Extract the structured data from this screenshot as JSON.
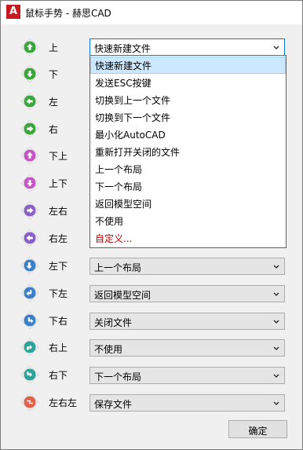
{
  "window": {
    "title": "鼠标手势 - 赫思CAD"
  },
  "app_icon": {
    "glyph": "A",
    "color": "#c8191f"
  },
  "gestures": [
    {
      "label": "上",
      "icon": "arrow-up-icon",
      "icon_color": "#3aa53a",
      "value": "快速新建文件"
    },
    {
      "label": "下",
      "icon": "arrow-down-icon",
      "icon_color": "#3aa53a"
    },
    {
      "label": "左",
      "icon": "arrow-left-icon",
      "icon_color": "#3aa53a"
    },
    {
      "label": "右",
      "icon": "arrow-right-icon",
      "icon_color": "#3aa53a"
    },
    {
      "label": "下上",
      "icon": "arrow-down-up-icon",
      "icon_color": "#c356c3"
    },
    {
      "label": "上下",
      "icon": "arrow-up-down-icon",
      "icon_color": "#c356c3"
    },
    {
      "label": "左右",
      "icon": "arrow-left-right-icon",
      "icon_color": "#8a5fc8"
    },
    {
      "label": "右左",
      "icon": "arrow-right-left-icon",
      "icon_color": "#8a5fc8"
    },
    {
      "label": "左下",
      "icon": "arrow-left-down-icon",
      "icon_color": "#3a7fc8",
      "value": "上一个布局"
    },
    {
      "label": "下左",
      "icon": "arrow-down-left-icon",
      "icon_color": "#3a7fc8",
      "value": "返回模型空间"
    },
    {
      "label": "下右",
      "icon": "arrow-down-right-icon",
      "icon_color": "#3a7fc8",
      "value": "关闭文件"
    },
    {
      "label": "右上",
      "icon": "arrow-right-up-icon",
      "icon_color": "#2aa39a",
      "value": "不使用"
    },
    {
      "label": "右下",
      "icon": "arrow-right-down-icon",
      "icon_color": "#2aa39a",
      "value": "下一个布局"
    },
    {
      "label": "左右左",
      "icon": "arrow-zigzag-icon",
      "icon_color": "#e0604a",
      "value": "保存文件"
    }
  ],
  "dropdown": {
    "selected_index": 0,
    "options": [
      "快速新建文件",
      "发送ESC按键",
      "切换到上一个文件",
      "切换到下一个文件",
      "最小化AutoCAD",
      "重新打开关闭的文件",
      "上一个布局",
      "下一个布局",
      "返回模型空间",
      "不使用",
      "自定义..."
    ]
  },
  "ok_label": "确定",
  "colors": {
    "custom_option": "#c00000",
    "selection": "#cce8ff",
    "focus_border": "#0078d7"
  }
}
